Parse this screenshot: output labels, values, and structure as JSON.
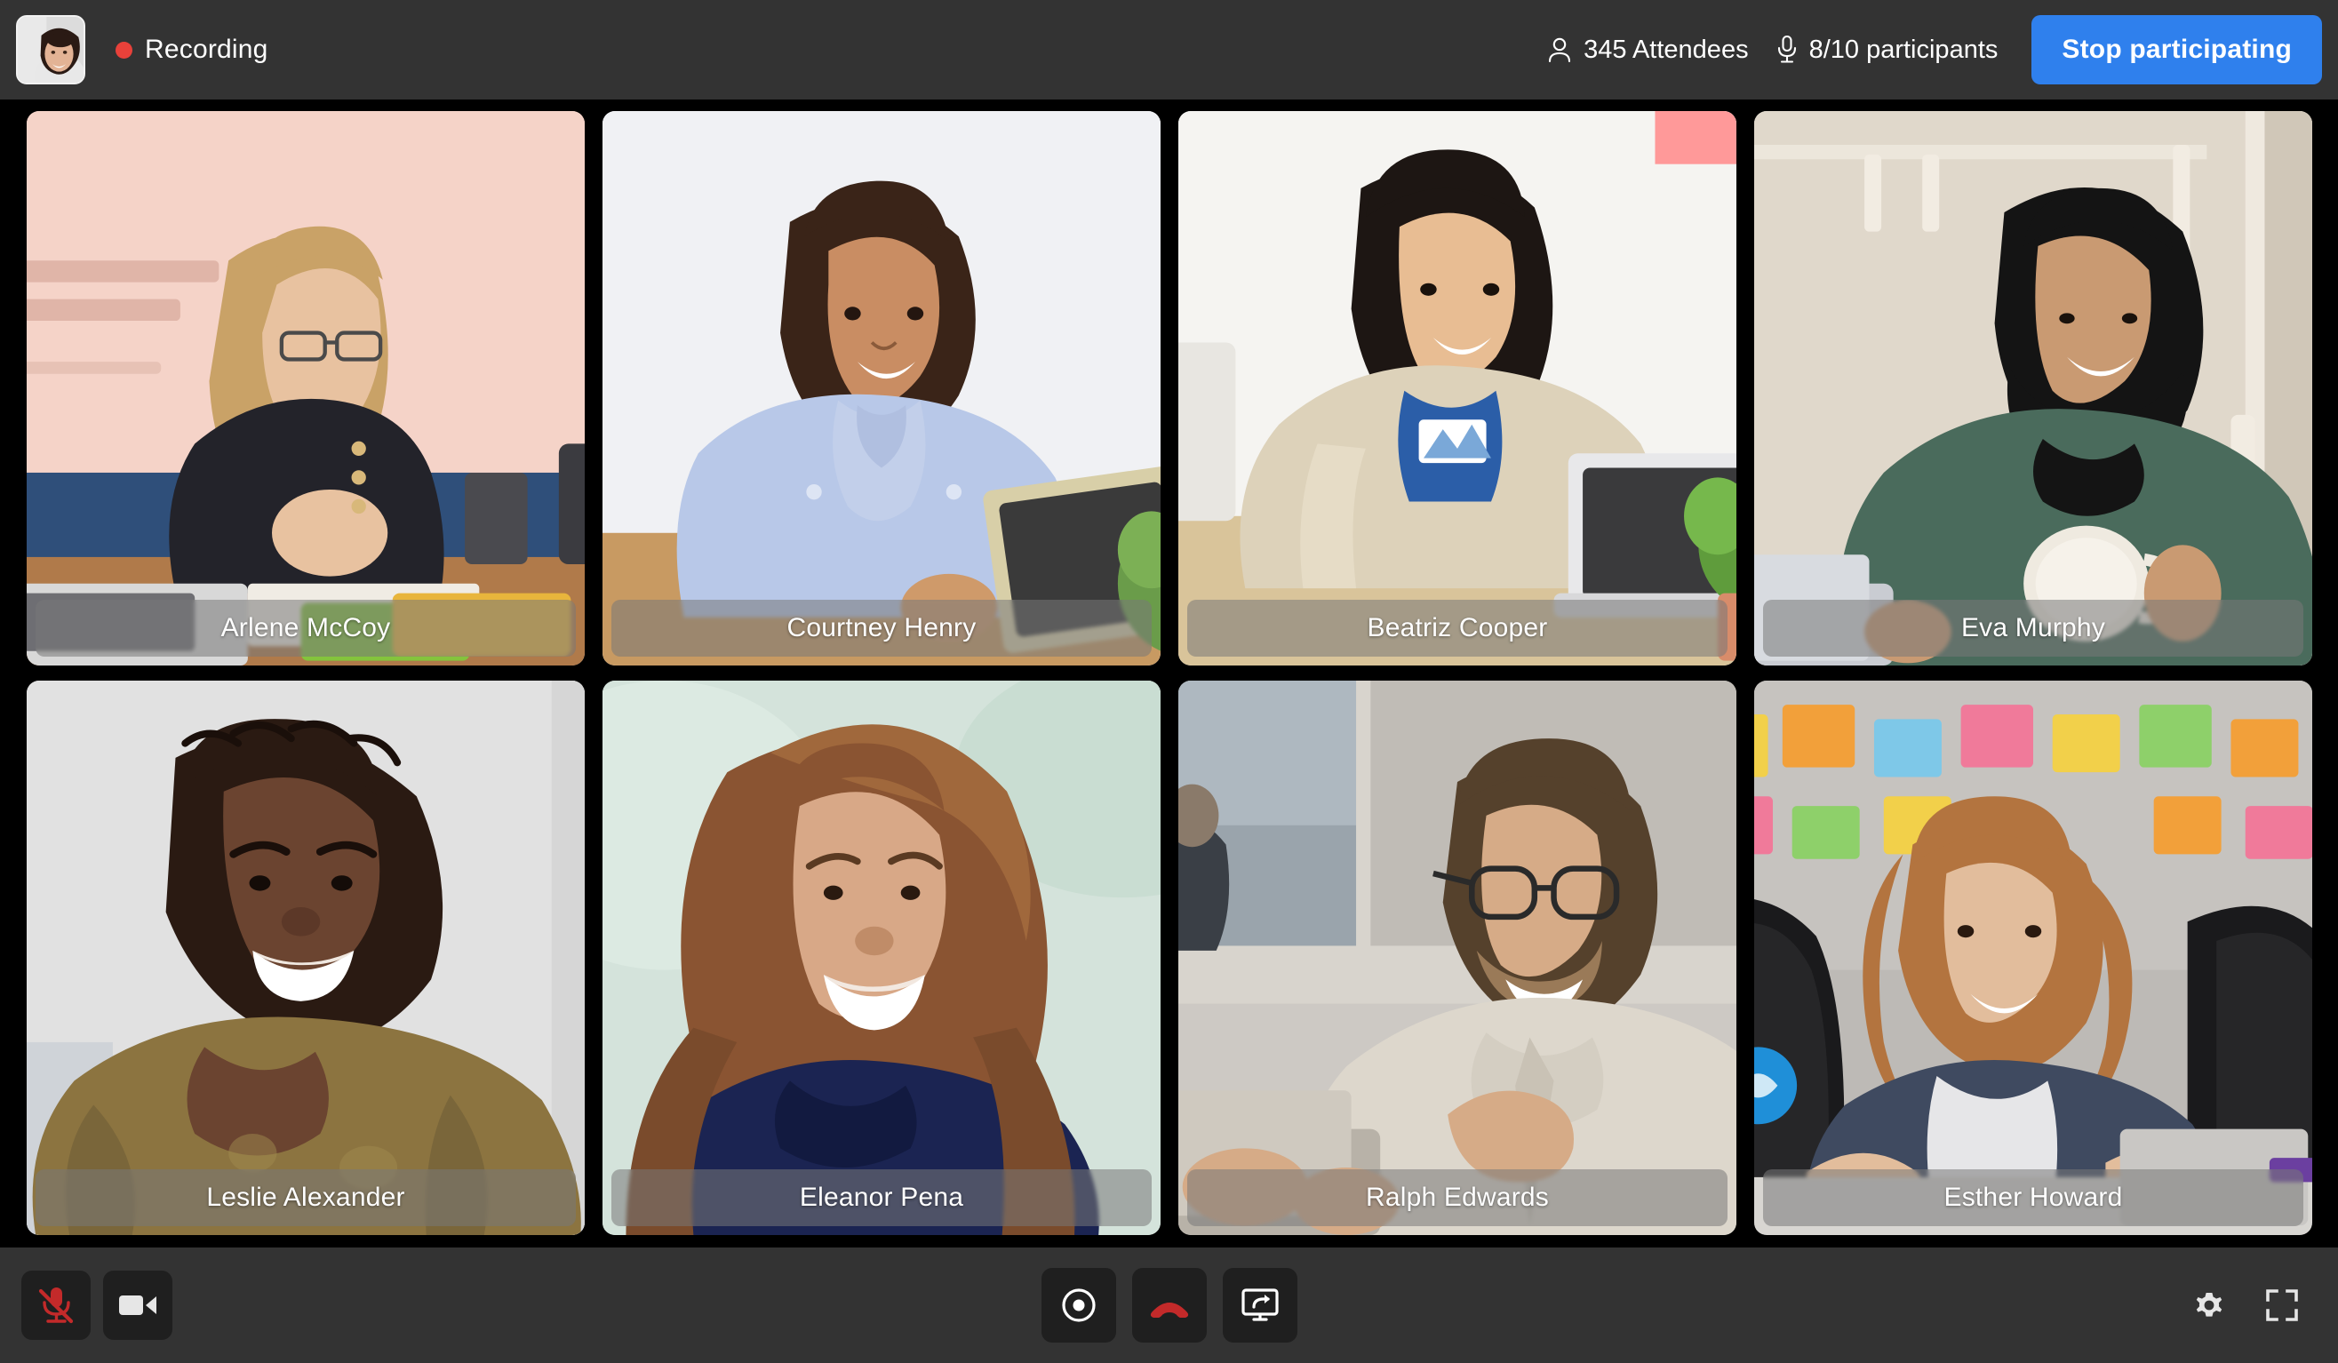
{
  "header": {
    "avatar": {
      "name": "self-avatar",
      "alt": "Self view thumbnail"
    },
    "recording_label": "Recording",
    "recording_dot_color": "#e8413a",
    "attendees_text": "345 Attendees",
    "attendees_icon": "person-icon",
    "participants_text": "8/10 participants",
    "participants_icon": "microphone-icon",
    "stop_button_label": "Stop participating",
    "stop_button_color": "#2f80ed",
    "background_color": "#333333"
  },
  "grid": {
    "columns": 4,
    "rows": 2,
    "tiles": [
      {
        "name": "Arlene McCoy",
        "bg": "#e8b9ad",
        "skin": "#e8c3a6",
        "hair": "#c8a060",
        "shirt": "#2a2a32",
        "wall": "#f2cfc4"
      },
      {
        "name": "Courtney Henry",
        "bg": "#e7e9ec",
        "skin": "#c98d63",
        "hair": "#3b2418",
        "shirt": "#b7c7e8",
        "wall": "#eef0f3"
      },
      {
        "name": "Beatriz Cooper",
        "bg": "#efeeea",
        "skin": "#e3b98f",
        "hair": "#1d1613",
        "shirt": "#ddd4bd",
        "wall": "#f4f2ee"
      },
      {
        "name": "Eva Murphy",
        "bg": "#ddd5c8",
        "skin": "#c99a72",
        "hair": "#151515",
        "shirt": "#4a6b5c",
        "wall": "#e2dacd"
      },
      {
        "name": "Leslie Alexander",
        "bg": "#dcdcdc",
        "skin": "#6b4430",
        "hair": "#23150f",
        "shirt": "#8c7440",
        "wall": "#e0e0e0"
      },
      {
        "name": "Eleanor Pena",
        "bg": "#cfe0d8",
        "skin": "#d8a887",
        "hair": "#7a4b2c",
        "shirt": "#1b2452",
        "wall": "#d6e5dd"
      },
      {
        "name": "Ralph Edwards",
        "bg": "#c9c5c0",
        "skin": "#d6ab87",
        "hair": "#55412c",
        "shirt": "#ddd7cc",
        "wall": "#cfccc8"
      },
      {
        "name": "Esther Howard",
        "bg": "#b9b6b2",
        "skin": "#e2bd9c",
        "hair": "#b3743f",
        "shirt": "#3f4a60",
        "wall": "#c4c1bd"
      }
    ]
  },
  "toolbar": {
    "background_color": "#333333",
    "mic_button": {
      "icon": "microphone-muted-icon",
      "label": "Unmute microphone",
      "state": "muted",
      "color": "#c32a2a"
    },
    "camera_button": {
      "icon": "video-camera-icon",
      "label": "Turn off camera",
      "state": "on",
      "color": "#e6e6e6"
    },
    "record_button": {
      "icon": "record-circle-icon",
      "label": "Record",
      "color": "#ffffff"
    },
    "end_call_button": {
      "icon": "phone-hangup-icon",
      "label": "End call",
      "color": "#c32a2a"
    },
    "share_button": {
      "icon": "screen-share-icon",
      "label": "Share screen",
      "color": "#ffffff"
    },
    "settings_button": {
      "icon": "gear-icon",
      "label": "Settings",
      "color": "#e6e6e6"
    },
    "fullscreen_button": {
      "icon": "fullscreen-icon",
      "label": "Fullscreen",
      "color": "#e6e6e6"
    }
  }
}
